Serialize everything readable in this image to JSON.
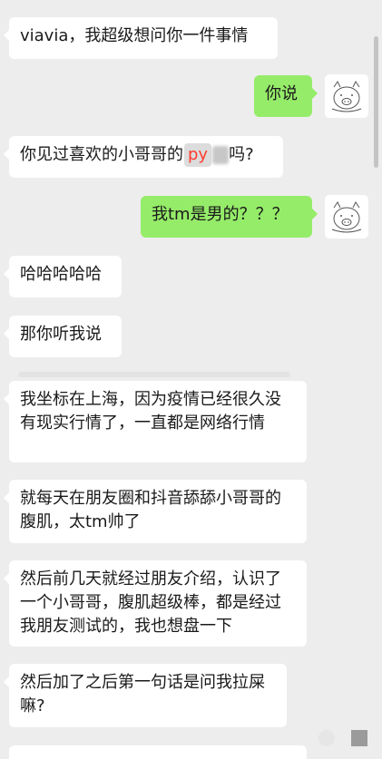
{
  "messages": [
    {
      "side": "left",
      "text": "viavia，我超级想问你一件事情"
    },
    {
      "side": "right",
      "text": "你说"
    },
    {
      "side": "left",
      "text_before": "你见过喜欢的小哥哥的",
      "highlight": "py",
      "text_after": "吗?"
    },
    {
      "side": "right",
      "text": "我tm是男的？？？"
    },
    {
      "side": "left",
      "text": "哈哈哈哈哈"
    },
    {
      "side": "left",
      "text": "那你听我说"
    },
    {
      "side": "left",
      "text": "我坐标在上海，因为疫情已经很久没有现实行情了，一直都是网络行情"
    },
    {
      "side": "left",
      "text": "就每天在朋友圈和抖音舔舔小哥哥的腹肌，太tm帅了"
    },
    {
      "side": "left",
      "text": "然后前几天就经过朋友介绍，认识了一个小哥哥，腹肌超级棒，都是经过我朋友测试的，我也想盘一下"
    },
    {
      "side": "left",
      "text": "然后加了之后第一句话是问我拉屎嘛?"
    }
  ],
  "colors": {
    "background": "#ededed",
    "bubble_left": "#ffffff",
    "bubble_right": "#95ec69",
    "highlight_text": "#ff3b30"
  },
  "avatar_icon": "pig-sketch-avatar"
}
